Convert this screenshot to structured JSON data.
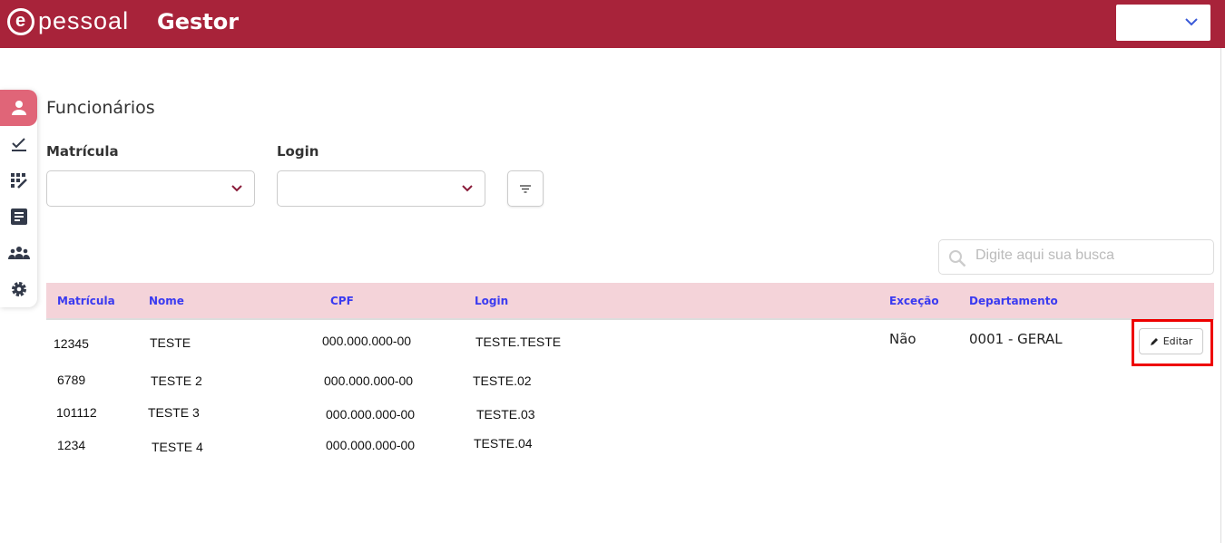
{
  "header": {
    "logo_text": "pessoal",
    "app_name": "Gestor",
    "selector_value": ""
  },
  "sidebar": {
    "items": [
      {
        "name": "funcionarios",
        "icon": "person-icon",
        "active": true
      },
      {
        "name": "aprovacoes",
        "icon": "check-icon"
      },
      {
        "name": "escalas",
        "icon": "grid-edit-icon"
      },
      {
        "name": "relatorios",
        "icon": "document-icon"
      },
      {
        "name": "grupos",
        "icon": "group-icon"
      },
      {
        "name": "configuracoes",
        "icon": "gear-icon"
      }
    ]
  },
  "page": {
    "title": "Funcionários"
  },
  "filters": {
    "matricula_label": "Matrícula",
    "login_label": "Login"
  },
  "search": {
    "placeholder": "Digite aqui sua busca",
    "value": ""
  },
  "table": {
    "headers": [
      "Matrícula",
      "Nome",
      "CPF",
      "Login",
      "Exceção",
      "Departamento"
    ],
    "rows": [
      {
        "matricula": "12345",
        "nome": "TESTE",
        "cpf": "000.000.000-00",
        "login": "TESTE.TESTE",
        "excecao": "Não",
        "departamento": "0001 - GERAL",
        "action": "Editar"
      },
      {
        "matricula": "6789",
        "nome": "TESTE 2",
        "cpf": "000.000.000-00",
        "login": "TESTE.02"
      },
      {
        "matricula": "101112",
        "nome": "TESTE 3",
        "cpf": "000.000.000-00",
        "login": "TESTE.03"
      },
      {
        "matricula": "1234",
        "nome": "TESTE 4",
        "cpf": "000.000.000-00",
        "login": "TESTE.04"
      }
    ]
  }
}
